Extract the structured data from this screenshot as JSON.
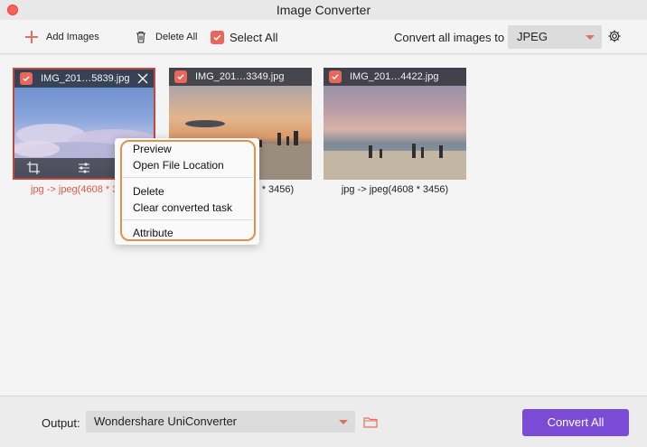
{
  "window": {
    "title": "Image Converter"
  },
  "toolbar": {
    "add_images": "Add Images",
    "delete_all": "Delete All",
    "select_all": "Select All",
    "convert_label": "Convert all images to",
    "format_value": "JPEG"
  },
  "images": [
    {
      "name": "IMG_201…5839.jpg",
      "caption": "jpg -> jpeg(4608 * 3456)"
    },
    {
      "name": "IMG_201…3349.jpg",
      "caption": "jpg -> jpeg(4608 * 3456)"
    },
    {
      "name": "IMG_201…4422.jpg",
      "caption": "jpg -> jpeg(4608 * 3456)"
    }
  ],
  "context_menu": {
    "preview": "Preview",
    "open_location": "Open File Location",
    "delete": "Delete",
    "clear_converted": "Clear converted task",
    "attribute": "Attribute"
  },
  "footer": {
    "output_label": "Output:",
    "output_value": "Wondershare UniConverter",
    "convert_all": "Convert All"
  },
  "colors": {
    "accent": "#e8675a",
    "convert_button": "#7b4bd6",
    "menu_highlight": "#e0914a"
  },
  "icons": [
    "plus-icon",
    "trash-icon",
    "checkmark-icon",
    "chevron-down-icon",
    "gear-icon",
    "close-icon",
    "crop-icon",
    "adjust-icon",
    "folder-icon"
  ]
}
